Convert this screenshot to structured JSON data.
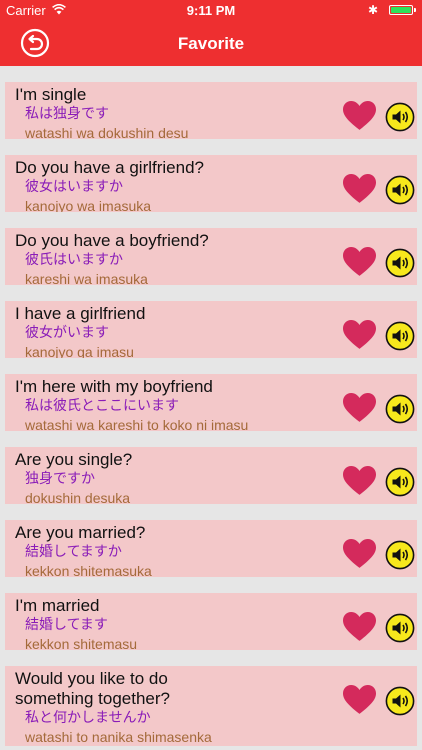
{
  "status_bar": {
    "carrier": "Carrier",
    "time": "9:11 PM"
  },
  "nav": {
    "title": "Favorite"
  },
  "phrases": [
    {
      "en": "I'm single",
      "jp": "私は独身です",
      "romaji": "watashi wa dokushin desu"
    },
    {
      "en": "Do you have a girlfriend?",
      "jp": "彼女はいますか",
      "romaji": "kanojyo wa imasuka"
    },
    {
      "en": "Do you have a boyfriend?",
      "jp": "彼氏はいますか",
      "romaji": "kareshi wa imasuka"
    },
    {
      "en": "I have a girlfriend",
      "jp": "彼女がいます",
      "romaji": "kanojyo ga imasu"
    },
    {
      "en": "I'm here with my boyfriend",
      "jp": "私は彼氏とここにいます",
      "romaji": "watashi wa kareshi to koko ni imasu"
    },
    {
      "en": "Are you single?",
      "jp": "独身ですか",
      "romaji": "dokushin desuka"
    },
    {
      "en": "Are you married?",
      "jp": "結婚してますか",
      "romaji": "kekkon shitemasuka"
    },
    {
      "en": "I'm married",
      "jp": "結婚してます",
      "romaji": "kekkon shitemasu"
    },
    {
      "en_line1": "Would you like to do",
      "en_line2": "something together?",
      "jp": "私と何かしませんか",
      "romaji": "watashi to nanika shimasenka"
    }
  ],
  "colors": {
    "nav": "#ee2f30",
    "row": "#f3c8c9",
    "heart": "#d42a5c",
    "speaker": "#f7e81c",
    "japanese": "#8a1cb8",
    "romaji": "#a46a3a"
  },
  "icons": {
    "back": "back-arrow-icon",
    "favorite": "heart-icon",
    "audio": "speaker-icon"
  }
}
